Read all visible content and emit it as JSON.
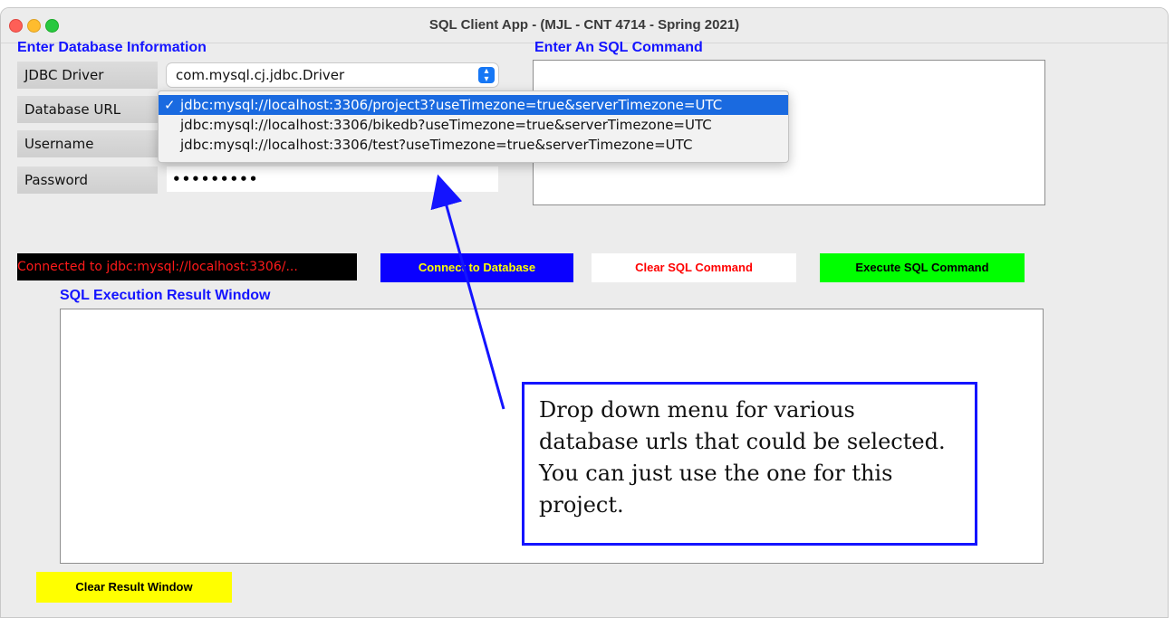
{
  "window": {
    "title": "SQL Client App - (MJL - CNT 4714 - Spring 2021)"
  },
  "db_info": {
    "heading": "Enter Database Information",
    "driver_label": "JDBC Driver",
    "driver_value": "com.mysql.cj.jdbc.Driver",
    "url_label": "Database URL",
    "username_label": "Username",
    "password_label": "Password",
    "password_value": "•••••••••"
  },
  "url_dropdown": {
    "options": [
      {
        "label": "jdbc:mysql://localhost:3306/project3?useTimezone=true&serverTimezone=UTC",
        "selected": true
      },
      {
        "label": "jdbc:mysql://localhost:3306/bikedb?useTimezone=true&serverTimezone=UTC",
        "selected": false
      },
      {
        "label": "jdbc:mysql://localhost:3306/test?useTimezone=true&serverTimezone=UTC",
        "selected": false
      }
    ],
    "check_mark": "✓"
  },
  "sql_command": {
    "heading": "Enter An SQL Command",
    "value": ""
  },
  "status": {
    "text": "Connected to jdbc:mysql://localhost:3306/..."
  },
  "buttons": {
    "connect": "Connect to Database",
    "clear_sql": "Clear SQL Command",
    "execute": "Execute SQL Command",
    "clear_result": "Clear Result Window"
  },
  "result": {
    "heading": "SQL Execution Result Window"
  },
  "callout": {
    "lines": [
      "Drop down menu for various",
      "database urls that could be selected.",
      "You can just use the one for this",
      "project."
    ]
  },
  "colors": {
    "heading_blue": "#1414ff",
    "connect_bg": "#0a00ff",
    "execute_bg": "#00ff00",
    "clear_result_bg": "#ffff00",
    "status_text": "#ff1a1a"
  }
}
